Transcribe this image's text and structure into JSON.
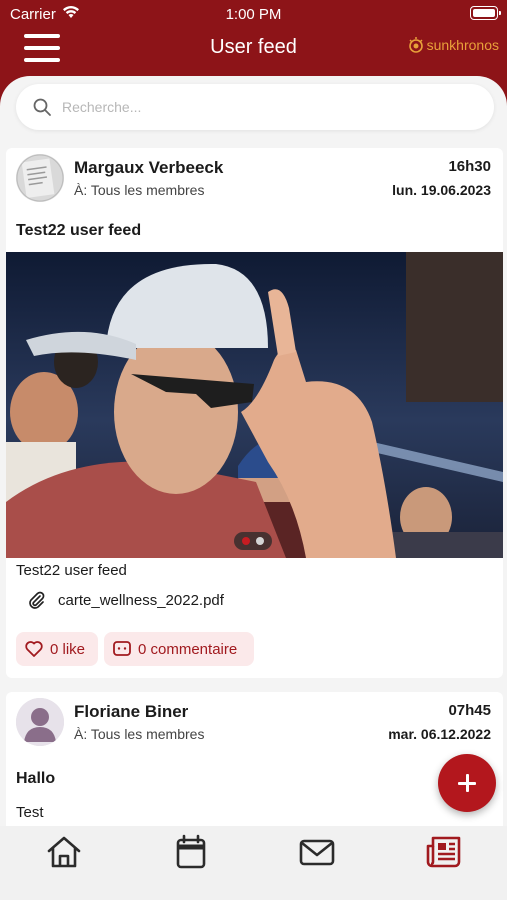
{
  "status": {
    "carrier": "Carrier",
    "time": "1:00 PM"
  },
  "header": {
    "title": "User feed",
    "brand": "sunkhronos"
  },
  "search": {
    "placeholder": "Recherche..."
  },
  "posts": [
    {
      "author": "Margaux Verbeeck",
      "recipients": "À: Tous les membres",
      "time": "16h30",
      "date": "lun. 19.06.2023",
      "title": "Test22 user feed",
      "body": "Test22 user feed",
      "attachment": "carte_wellness_2022.pdf",
      "likes_label": "0 like",
      "comments_label": "0 commentaire",
      "carousel": {
        "slides": 2,
        "active": 1
      }
    },
    {
      "author": "Floriane Biner",
      "recipients": "À: Tous les membres",
      "time": "07h45",
      "date": "mar. 06.12.2022",
      "title": "Hallo",
      "body": "Test"
    }
  ],
  "tabs": [
    {
      "icon": "home-icon"
    },
    {
      "icon": "calendar-icon"
    },
    {
      "icon": "mail-icon"
    },
    {
      "icon": "newspaper-icon",
      "active": true
    }
  ],
  "colors": {
    "brand": "#8d1418",
    "accent": "#b3171d",
    "pill_bg": "#fbe9ea",
    "brand_logo": "#e8a03a"
  }
}
